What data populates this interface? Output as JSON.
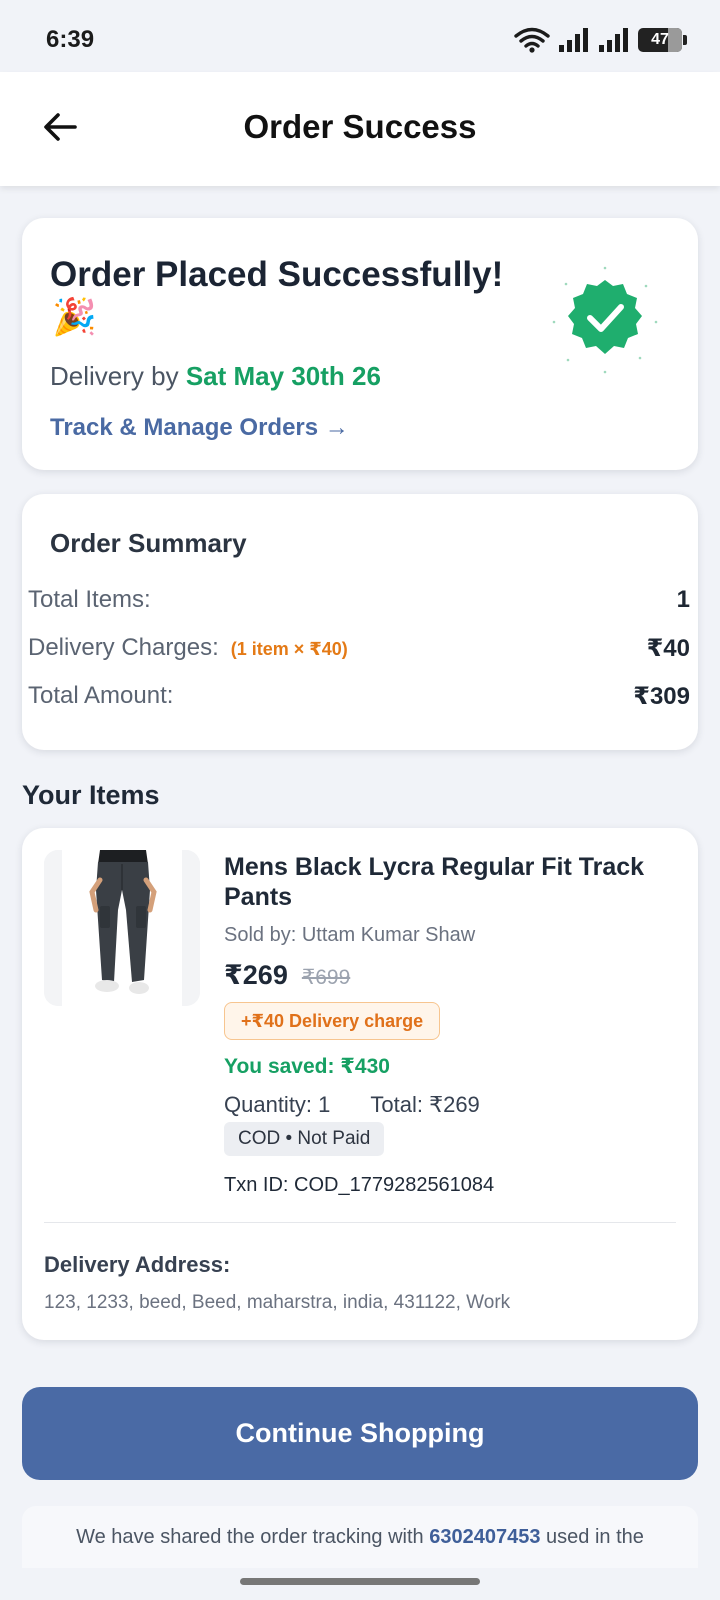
{
  "status_bar": {
    "time": "6:39",
    "battery": "47"
  },
  "header": {
    "title": "Order Success"
  },
  "success_card": {
    "title": "Order Placed Successfully!",
    "emoji": "🎉",
    "delivery_prefix": "Delivery by",
    "delivery_date": "Sat May 30th 26",
    "track_link": "Track & Manage Orders →"
  },
  "order_summary": {
    "title": "Order Summary",
    "rows": [
      {
        "label": "Total Items:",
        "note": "",
        "value": "1"
      },
      {
        "label": "Delivery Charges:",
        "note": "(1 item × ₹40)",
        "value": "₹40"
      },
      {
        "label": "Total Amount:",
        "note": "",
        "value": "₹309"
      }
    ]
  },
  "items": {
    "heading": "Your Items",
    "product": {
      "name": "Mens Black Lycra Regular Fit Track Pants",
      "sold_by": "Sold by: Uttam Kumar Shaw",
      "price": "₹269",
      "mrp": "₹699",
      "delivery_charge": "+₹40 Delivery charge",
      "saved": "You saved: ₹430",
      "quantity": "Quantity: 1",
      "total": "Total: ₹269",
      "payment_status": "COD • Not Paid",
      "txn_id": "Txn ID: COD_1779282561084"
    },
    "address_label": "Delivery Address:",
    "address": "123, 1233, beed, Beed, maharstra, india, 431122, Work"
  },
  "continue_button": "Continue Shopping",
  "info": {
    "prefix": "We have shared the order tracking with ",
    "phone": "6302407453",
    "suffix": " used in the"
  },
  "colors": {
    "accent": "#4a6aa5",
    "success": "#16a063",
    "warning": "#e0711a"
  }
}
